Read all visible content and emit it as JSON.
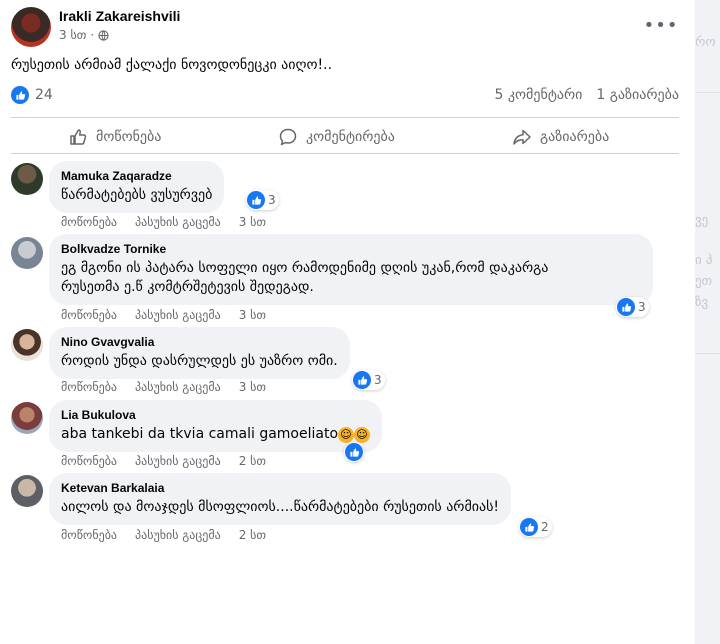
{
  "post": {
    "author": "Irakli Zakareishvili",
    "time": "3 სთ",
    "separator": "·",
    "text": "რუსეთის არმიამ ქალაქი ნოვოდონეცკი აიღო!..",
    "reaction_count": "24",
    "comments_count": "5 კომენტარი",
    "shares_count": "1 გაზიარება",
    "more_icon": "more-horizontal-icon",
    "privacy_icon": "globe-icon"
  },
  "actions": {
    "like": "მოწონება",
    "comment": "კომენტირება",
    "share": "გაზიარება"
  },
  "colors": {
    "accent": "#1877f2",
    "bubble": "#f0f2f5",
    "secondary_text": "#65676b"
  },
  "comments": [
    {
      "name": "Mamuka Zaqaradze",
      "text": "წარმატებებს ვუსურვებ",
      "like": "მოწონება",
      "reply": "პასუხის გაცემა",
      "time": "3 სთ",
      "reactions": "3"
    },
    {
      "name": "Bolkvadze Tornike",
      "text": "ეგ მგონი ის პატარა სოფელი იყო რამოდენიმე დღის უკან,რომ დაკარგა\nრუსეთმა ე.წ კომტრშეტევის შედეგად.",
      "like": "მოწონება",
      "reply": "პასუხის გაცემა",
      "time": "3 სთ",
      "reactions": "3"
    },
    {
      "name": "Nino Gvavgvalia",
      "text": "როდის უნდა დასრულდეს ეს უაზრო ომი.",
      "like": "მოწონება",
      "reply": "პასუხის გაცემა",
      "time": "3 სთ",
      "reactions": "3"
    },
    {
      "name": "Lia Bukulova",
      "text": "aba tankebi da tkvia camali gamoeliato",
      "like": "მოწონება",
      "reply": "პასუხის გაცემა",
      "time": "2 სთ",
      "reactions": ""
    },
    {
      "name": "Ketevan Barkalaia",
      "text": "აილოს და მოაჯდეს მსოფლიოს....წარმატებები რუსეთის არმიას!",
      "like": "მოწონება",
      "reply": "პასუხის გაცემა",
      "time": "2 სთ",
      "reactions": "2"
    }
  ],
  "sidebar_fragments": [
    "რო",
    "ვე",
    "ი პ",
    "ეთ",
    "ზვ"
  ]
}
